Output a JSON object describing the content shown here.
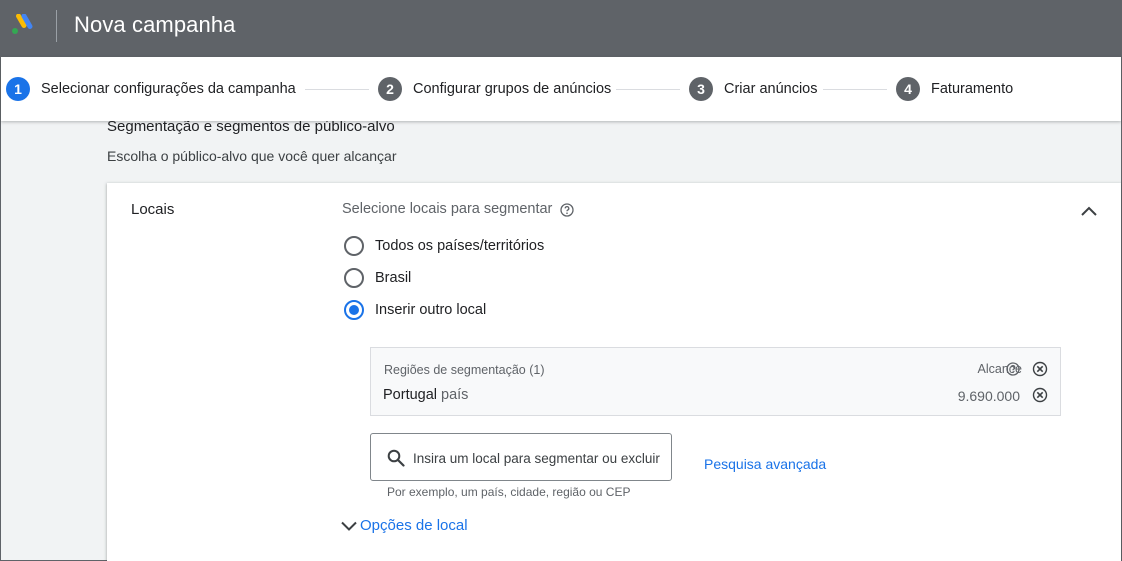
{
  "header": {
    "title": "Nova campanha"
  },
  "stepper": {
    "steps": [
      {
        "number": "1",
        "label": "Selecionar configurações da campanha"
      },
      {
        "number": "2",
        "label": "Configurar grupos de anúncios"
      },
      {
        "number": "3",
        "label": "Criar anúncios"
      },
      {
        "number": "4",
        "label": "Faturamento"
      }
    ]
  },
  "section": {
    "title": "Segmentação e segmentos de público-alvo",
    "subtitle": "Escolha o público-alvo que você quer alcançar"
  },
  "locations": {
    "label": "Locais",
    "select_label": "Selecione locais para segmentar",
    "options": [
      {
        "label": "Todos os países/territórios",
        "checked": false
      },
      {
        "label": "Brasil",
        "checked": false
      },
      {
        "label": "Inserir outro local",
        "checked": true
      }
    ],
    "targets": {
      "header": "Regiões de segmentação (1)",
      "reach_label": "Alcance",
      "items": [
        {
          "name": "Portugal",
          "type": "país",
          "reach": "9.690.000"
        }
      ]
    },
    "search": {
      "placeholder": "Insira um local para segmentar ou excluir",
      "hint": "Por exemplo, um país, cidade, região ou CEP"
    },
    "advanced_search": "Pesquisa avançada",
    "location_options": "Opções de local"
  },
  "colors": {
    "topbar": "#5f6368",
    "accent": "#1a73e8",
    "step_inactive": "#5f6368"
  }
}
